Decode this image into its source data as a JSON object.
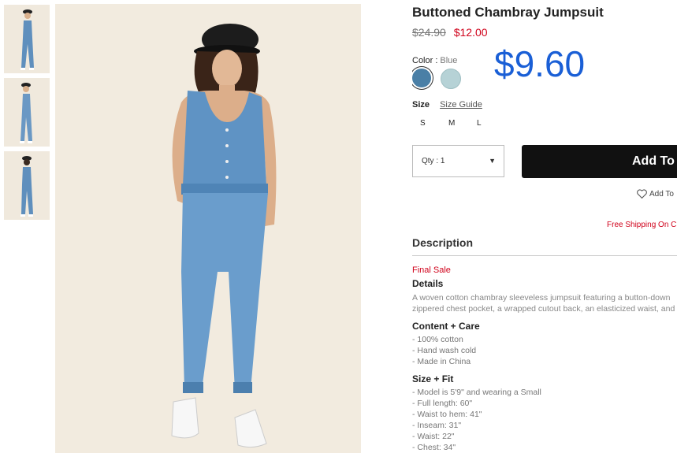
{
  "product": {
    "title": "Buttoned Chambray Jumpsuit",
    "price_original": "$24.90",
    "price_sale": "$12.00",
    "price_overlay": "$9.60"
  },
  "color": {
    "label": "Color :",
    "selected": "Blue",
    "swatches": [
      "#4a7fa6",
      "#b6d2d6"
    ]
  },
  "size": {
    "label": "Size",
    "guide": "Size Guide",
    "options": [
      "S",
      "M",
      "L"
    ]
  },
  "quantity": {
    "label": "Qty : 1"
  },
  "actions": {
    "add_to_bag": "Add To",
    "wishlist": "Add To",
    "free_shipping": "Free Shipping On C"
  },
  "description": {
    "heading": "Description",
    "final_sale": "Final Sale",
    "details_heading": "Details",
    "details_lines": [
      "A woven cotton chambray sleeveless jumpsuit featuring a button-down",
      "zippered chest pocket, a wrapped cutout back, an elasticized waist, and"
    ],
    "content_heading": "Content + Care",
    "content_items": [
      "- 100% cotton",
      "- Hand wash cold",
      "- Made in China"
    ],
    "fit_heading": "Size + Fit",
    "fit_items": [
      "- Model is 5'9\" and wearing a Small",
      "- Full length: 60\"",
      "- Waist to hem: 41\"",
      "- Inseam: 31\"",
      "- Waist: 22\"",
      "- Chest: 34\""
    ]
  },
  "colors": {
    "sale": "#d0021b",
    "overlay_price": "#1a5fd6",
    "button": "#111111"
  }
}
